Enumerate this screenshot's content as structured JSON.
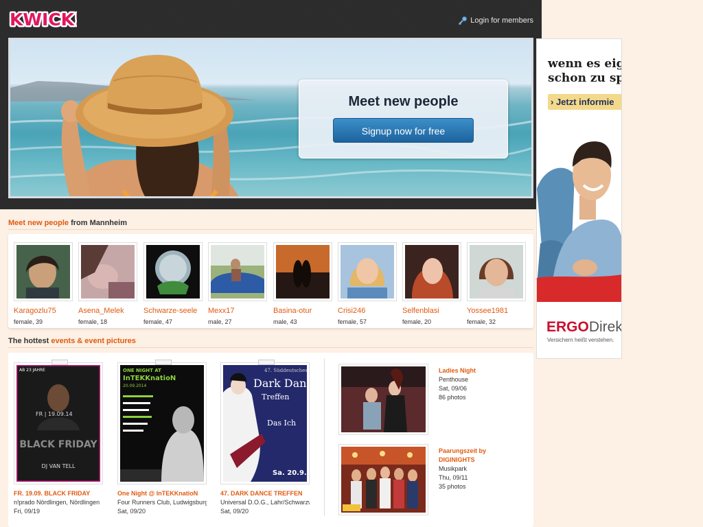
{
  "header": {
    "logo_text": "KWICK!",
    "login_label": "Login for members"
  },
  "hero": {
    "title": "Meet new people",
    "signup_label": "Signup now for free"
  },
  "ad": {
    "headline_line1": "wenn es eige",
    "headline_line2": "schon zu spä",
    "button_label": "› Jetzt informie",
    "brand": "ERGO",
    "brand_suffix": "Direk",
    "tagline": "Versichern heißt verstehen."
  },
  "people_section": {
    "title_highlight": "Meet new people",
    "title_rest": " from Mannheim",
    "people": [
      {
        "name": "Karagozlu75",
        "info": "female, 39"
      },
      {
        "name": "Asena_Melek",
        "info": "female, 18"
      },
      {
        "name": "Schwarze-seele",
        "info": "female, 47"
      },
      {
        "name": "Mexx17",
        "info": "male, 27"
      },
      {
        "name": "Basina-otur",
        "info": "male, 43"
      },
      {
        "name": "Crisi246",
        "info": "female, 57"
      },
      {
        "name": "Selfenblasi",
        "info": "female, 20"
      },
      {
        "name": "Yossee1981",
        "info": "female, 32"
      }
    ]
  },
  "events_section": {
    "title_rest": "The hottest ",
    "title_highlight": "events & event pictures",
    "events": [
      {
        "title": "FR. 19.09. BLACK FRIDAY",
        "location": "n!prado Nördlingen, Nördlingen",
        "date": "Fri, 09/19",
        "poster_top": "AB 23 JAHRE",
        "poster_date": "FR | 19.09.14",
        "poster_main": "BLACK FRIDAY",
        "poster_dj": "DJ VAN TELL"
      },
      {
        "title": "One Night @ InTEKKnatioN",
        "location": "Four Runners Club, Ludwigsburg",
        "date": "Sat, 09/20",
        "poster_top": "ONE NIGHT AT",
        "poster_main": "InTEKKnatioN",
        "poster_date": "20.09.2014"
      },
      {
        "title": "47. DARK DANCE TREFFEN",
        "location": "Universal D.O.G., Lahr/Schwarzwald",
        "date": "Sat, 09/20",
        "poster_top": "47. Süddeutsches",
        "poster_main": "Dark Dance",
        "poster_sub": "Treffen",
        "poster_act": "Das Ich",
        "poster_date": "Sa. 20.9."
      }
    ],
    "albums": [
      {
        "title": "Ladies Night",
        "place": "Penthouse",
        "date": "Sat, 09/06",
        "photos": "86 photos"
      },
      {
        "title": "Paarungszeit by DIGINIGHTS",
        "place": "Musikpark",
        "date": "Thu, 09/11",
        "photos": "35 photos"
      }
    ]
  }
}
